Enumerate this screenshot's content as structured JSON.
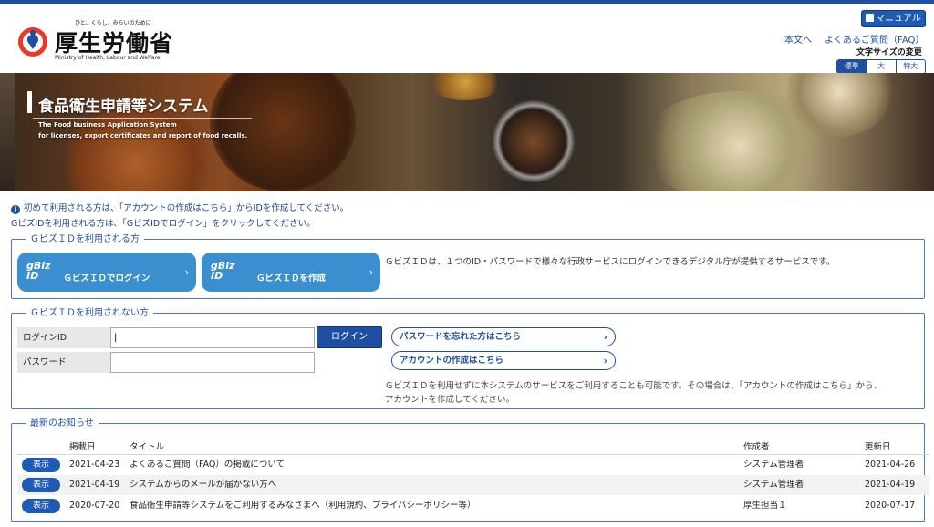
{
  "colors": {
    "primary": "#1f4fa3",
    "gbiz": "#3c8fce"
  },
  "header": {
    "tagline": "ひと、くらし、みらいのために",
    "logo_text": "厚生労働省",
    "logo_english": "Ministry of Health, Labour and Welfare",
    "manual_label": "マニュアル",
    "links": [
      "本文へ",
      "よくあるご質問（FAQ）"
    ],
    "font_size_label": "文字サイズの変更",
    "font_sizes": [
      "標準",
      "大",
      "特大"
    ],
    "font_size_selected": "標準"
  },
  "banner": {
    "title": "食品衛生申請等システム",
    "subtitle_line1": "The Food business Application System",
    "subtitle_line2": "for licenses, export certificates and report of food recalls."
  },
  "notices": [
    "初めて利用される方は、「アカウントの作成はこちら」からIDを作成してください。",
    "GビズIDを利用される方は、「GビズIDでログイン」をクリックしてください。"
  ],
  "gbiz_section": {
    "legend": "ＧビズＩＤを利用される方",
    "logo_line1": "gBiz",
    "logo_line2": "ID",
    "login_label": "ＧビズＩＤでログイン",
    "create_label": "ＧビズＩＤを作成",
    "description": "ＧビズＩＤは、１つのID・パスワードで様々な行政サービスにログインできるデジタル庁が提供するサービスです。"
  },
  "login_section": {
    "legend": "ＧビズＩＤを利用されない方",
    "id_label": "ログインID",
    "password_label": "パスワード",
    "id_value": "|",
    "password_value": "",
    "login_button": "ログイン",
    "forgot_password": "パスワードを忘れた方はこちら",
    "create_account": "アカウントの作成はこちら",
    "description_line1": "ＧビズＩＤを利用せずに本システムのサービスをご利用することも可能です。その場合は、「アカウントの作成はこちら」から、",
    "description_line2": "アカウントを作成してください。"
  },
  "news": {
    "legend": "最新のお知らせ",
    "headers": {
      "date": "掲載日",
      "title": "タイトル",
      "author": "作成者",
      "updated": "更新日"
    },
    "view_label": "表示",
    "rows": [
      {
        "date": "2021-04-23",
        "title": "よくあるご質問（FAQ）の掲載について",
        "author": "システム管理者",
        "updated": "2021-04-26"
      },
      {
        "date": "2021-04-19",
        "title": "システムからのメールが届かない方へ",
        "author": "システム管理者",
        "updated": "2021-04-19"
      },
      {
        "date": "2020-07-20",
        "title": "食品衛生申請等システムをご利用するみなさまへ（利用規約、プライバシーポリシー等）",
        "author": "厚生担当１",
        "updated": "2020-07-17"
      }
    ]
  }
}
